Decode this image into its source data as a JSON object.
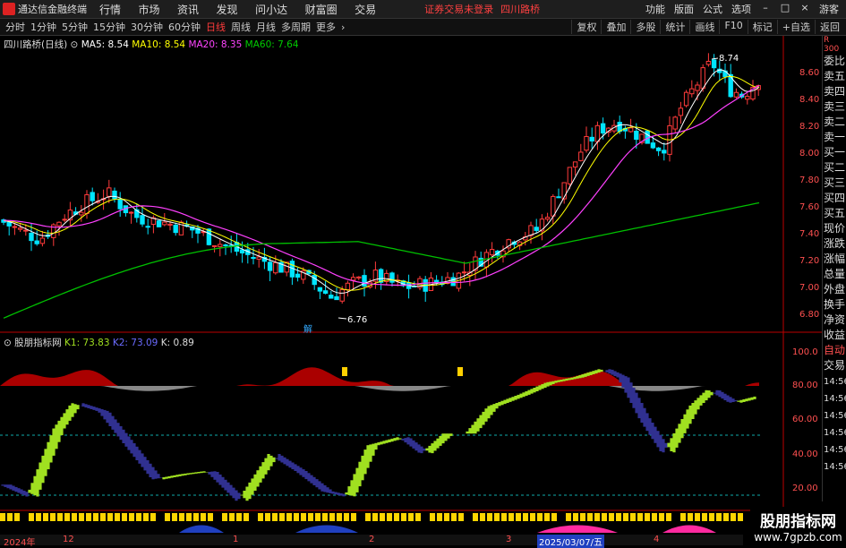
{
  "app": {
    "title": "通达信金融终端",
    "status": "证券交易未登录",
    "stock": "四川路桥"
  },
  "menu": [
    "行情",
    "市场",
    "资讯",
    "发现",
    "问小达",
    "财富圈",
    "交易"
  ],
  "right_menu": [
    "功能",
    "版面",
    "公式",
    "选项",
    "游客"
  ],
  "toolbar": {
    "periods": [
      "分时",
      "1分钟",
      "5分钟",
      "15分钟",
      "30分钟",
      "60分钟",
      "日线",
      "周线",
      "月线",
      "多周期",
      "更多"
    ],
    "active_period": "日线",
    "buttons": [
      "复权",
      "叠加",
      "多股",
      "统计",
      "画线",
      "F10",
      "标记",
      "+自选",
      "返回"
    ]
  },
  "main_panel": {
    "title": "四川路桥(日线)",
    "ma5": "MA5: 8.54",
    "ma10": "MA10: 8.54",
    "ma20": "MA20: 8.35",
    "ma60": "MA60: 7.64",
    "y_ticks": [
      "8.60",
      "8.40",
      "8.20",
      "8.00",
      "7.80",
      "7.60",
      "7.40",
      "7.20",
      "7.00",
      "6.80"
    ],
    "high_label": "8.74",
    "low_label": "6.76",
    "marker": "解"
  },
  "indicator_panel": {
    "title": "股朋指标网",
    "k1": "K1: 73.83",
    "k2": "K2: 73.09",
    "k": "K: 0.89",
    "y_ticks": [
      "100.0",
      "80.00",
      "60.00",
      "40.00",
      "20.00"
    ]
  },
  "time_axis": [
    "2024年",
    "12",
    "1",
    "2",
    "3",
    "4"
  ],
  "cursor_date": "2025/03/07/五",
  "right_tabs": [
    "委比",
    "卖五",
    "卖四",
    "卖三",
    "卖二",
    "卖一",
    "买一",
    "买二",
    "买三",
    "买四",
    "买五",
    "现价",
    "涨跌",
    "涨幅",
    "总量",
    "外盘",
    "换手",
    "净资",
    "收益",
    "自动",
    "交易"
  ],
  "time_ticks": [
    "14:56",
    "14:56",
    "14:56",
    "14:56",
    "14:56",
    "14:56",
    "14:56"
  ],
  "watermark": {
    "cn": "股朋指标网",
    "url": "www.7gpzb.com"
  },
  "colors": {
    "up": "#ff3b3b",
    "down": "#00ffff",
    "ma5": "#ffffff",
    "ma10": "#ffff00",
    "ma20": "#ff40ff",
    "ma60": "#00c000",
    "lime": "#a0e020",
    "navy": "#303090"
  }
}
